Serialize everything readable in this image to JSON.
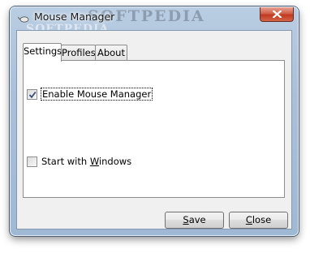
{
  "window": {
    "title": "Mouse Manager",
    "watermark_main": "SOFTPEDIA",
    "watermark_sub": "SOFTPEDIA",
    "icon": "mouse-icon"
  },
  "tabs": [
    {
      "label": "Settings",
      "active": true
    },
    {
      "label": "Profiles",
      "active": false
    },
    {
      "label": "About",
      "active": false
    }
  ],
  "settings": {
    "enable_label": "Enable Mouse Manager",
    "enable_checked": true,
    "startup_label_before": "Start with ",
    "startup_label_accel": "W",
    "startup_label_after": "indows",
    "startup_checked": false
  },
  "buttons": {
    "save_accel": "S",
    "save_rest": "ave",
    "close_accel": "C",
    "close_rest": "lose"
  },
  "colors": {
    "title_bar": "#a9c0d9",
    "close_button": "#c0391f"
  }
}
